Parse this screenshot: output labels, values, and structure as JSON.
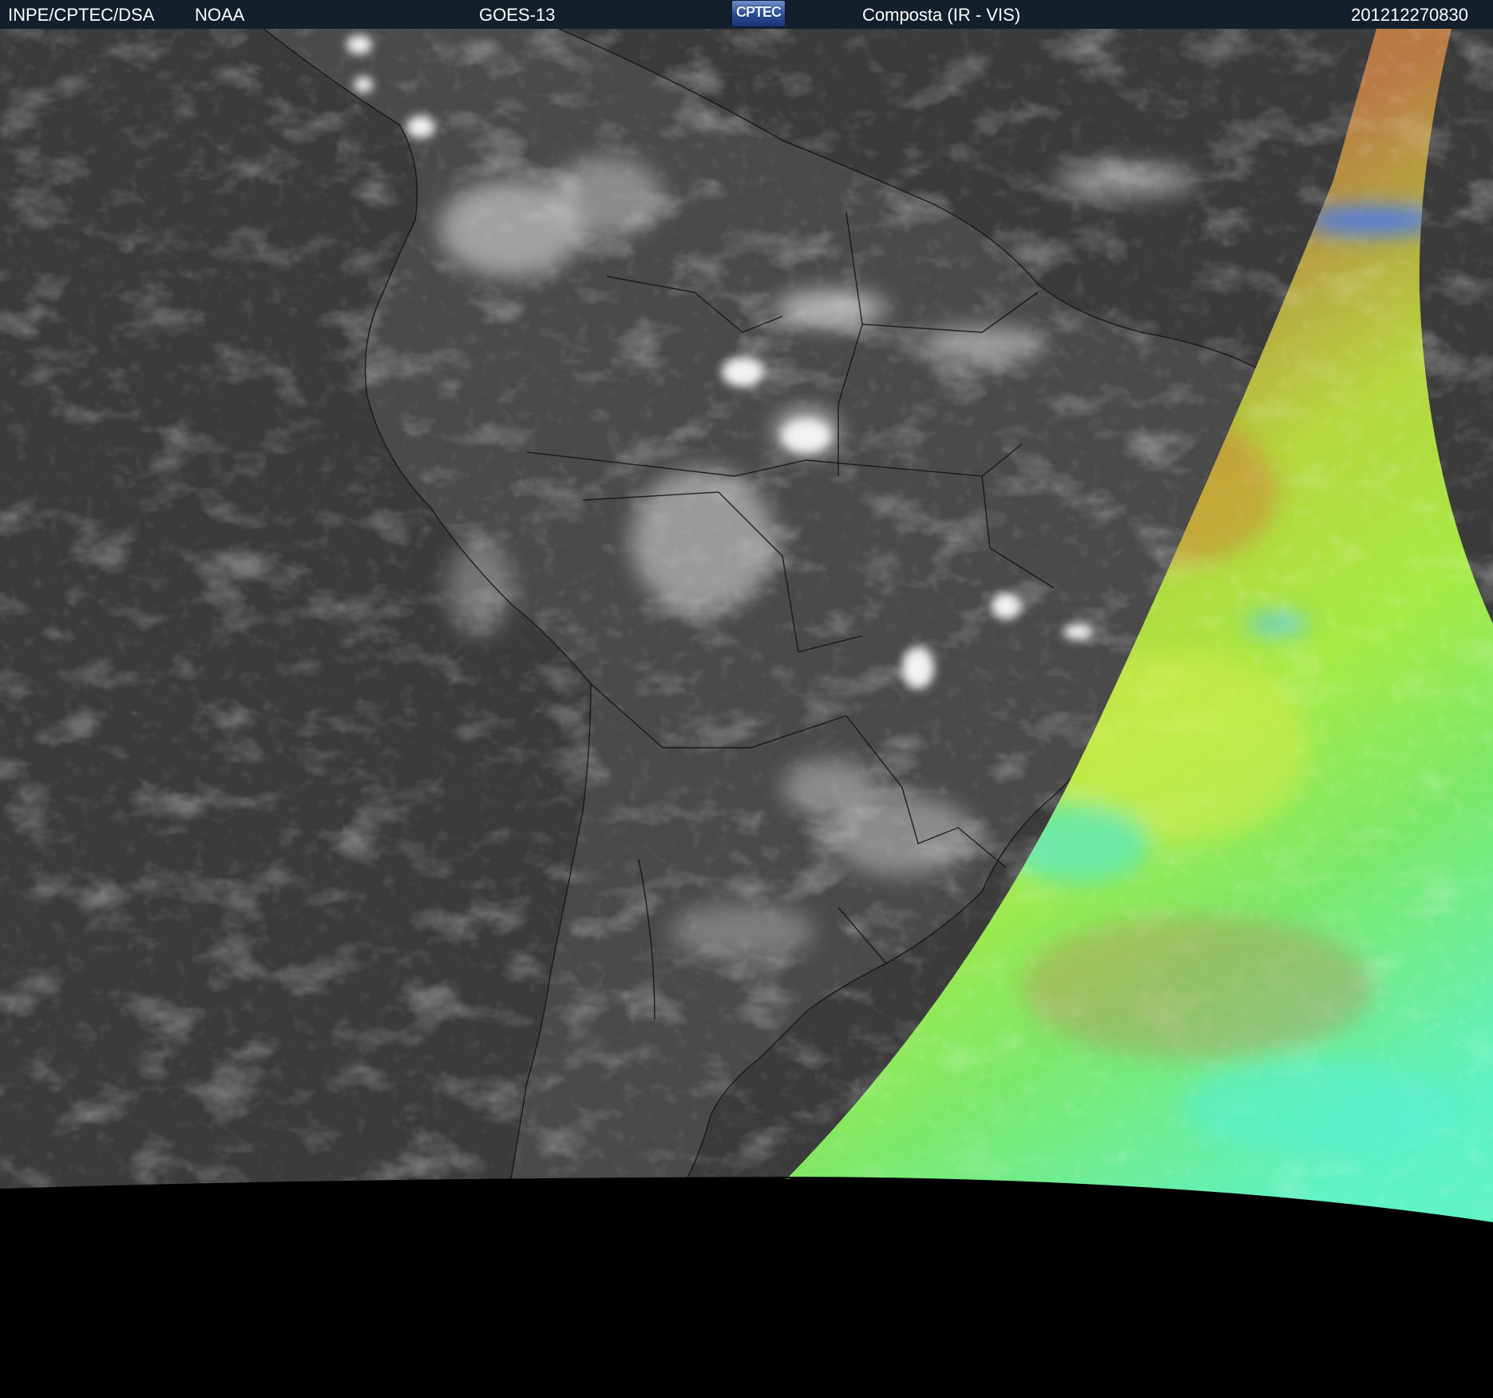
{
  "header": {
    "organization": "INPE/CPTEC/DSA",
    "agency": "NOAA",
    "satellite": "GOES-13",
    "logo_text": "CPTEC",
    "product": "Composta (IR - VIS)",
    "timestamp": "201212270830"
  },
  "colors": {
    "header_bg": "#13202c",
    "ir_ocean": "#3a3a3a",
    "ir_land": "#4a4a4a",
    "vis_orange": "#c9723a",
    "vis_yellow_green": "#b6e03e",
    "vis_cyan": "#5ef2c4",
    "space": "#000000"
  }
}
